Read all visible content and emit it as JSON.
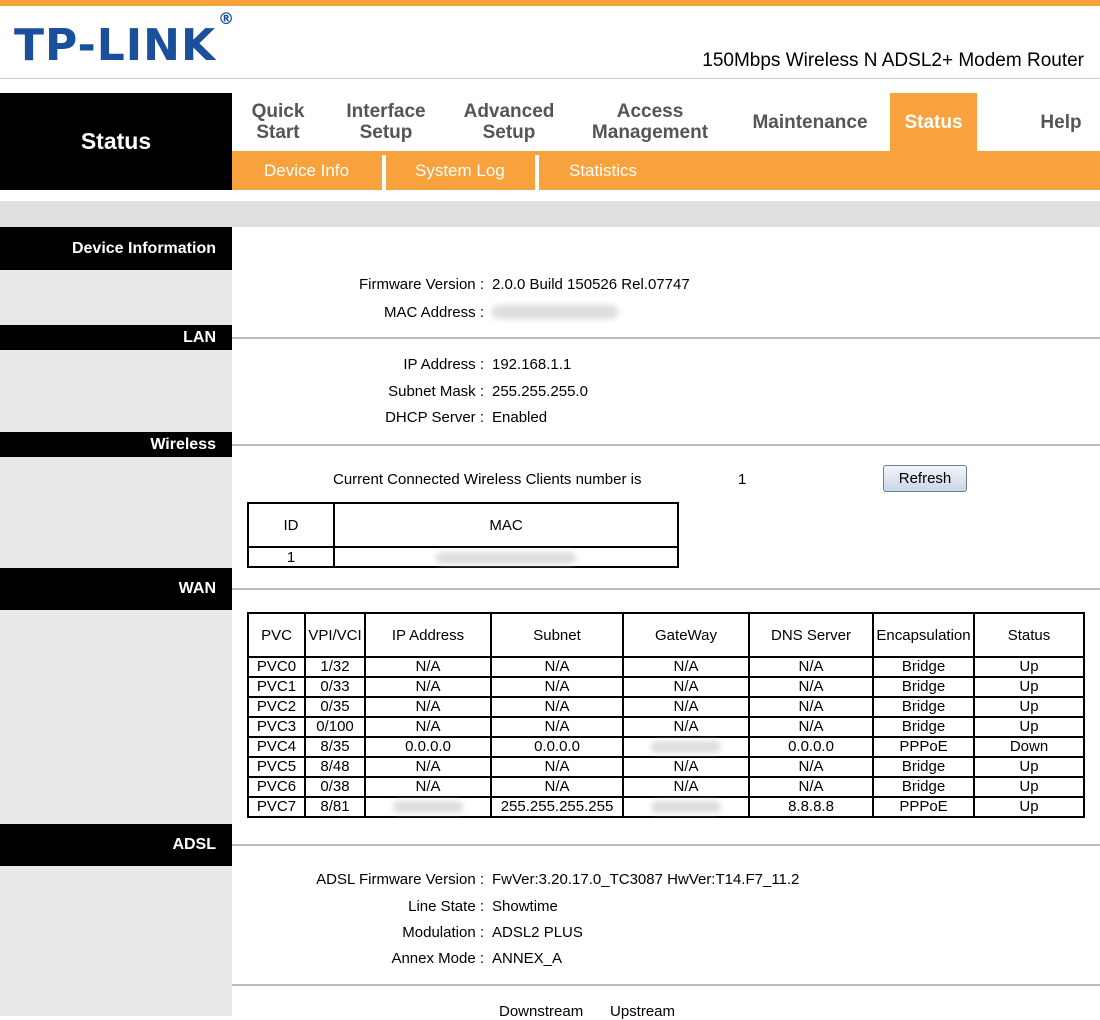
{
  "brand": {
    "logo": "TP-LINK",
    "reg": "®",
    "model": "150Mbps Wireless N ADSL2+ Modem Router"
  },
  "page_title": "Status",
  "nav": {
    "items": [
      "Quick Start",
      "Interface Setup",
      "Advanced Setup",
      "Access Management",
      "Maintenance",
      "Status",
      "Help"
    ],
    "active": "Status"
  },
  "subnav": {
    "items": [
      "Device Info",
      "System Log",
      "Statistics"
    ]
  },
  "sections": {
    "device_info": "Device Information",
    "lan": "LAN",
    "wireless": "Wireless",
    "wan": "WAN",
    "adsl": "ADSL"
  },
  "device": {
    "firmware_label": "Firmware Version :",
    "firmware_value": "2.0.0 Build 150526 Rel.07747",
    "mac_label": "MAC Address :"
  },
  "lan": {
    "ip_label": "IP Address :",
    "ip_value": "192.168.1.1",
    "subnet_label": "Subnet Mask :",
    "subnet_value": "255.255.255.0",
    "dhcp_label": "DHCP Server :",
    "dhcp_value": "Enabled"
  },
  "wireless": {
    "clients_label": "Current Connected Wireless Clients number is",
    "clients_count": "1",
    "refresh_label": "Refresh",
    "columns": [
      "ID",
      "MAC"
    ],
    "rows": [
      {
        "id": "1"
      }
    ]
  },
  "wan": {
    "columns": [
      "PVC",
      "VPI/VCI",
      "IP Address",
      "Subnet",
      "GateWay",
      "DNS Server",
      "Encapsulation",
      "Status"
    ],
    "rows": [
      [
        "PVC0",
        "1/32",
        "N/A",
        "N/A",
        "N/A",
        "N/A",
        "Bridge",
        "Up"
      ],
      [
        "PVC1",
        "0/33",
        "N/A",
        "N/A",
        "N/A",
        "N/A",
        "Bridge",
        "Up"
      ],
      [
        "PVC2",
        "0/35",
        "N/A",
        "N/A",
        "N/A",
        "N/A",
        "Bridge",
        "Up"
      ],
      [
        "PVC3",
        "0/100",
        "N/A",
        "N/A",
        "N/A",
        "N/A",
        "Bridge",
        "Up"
      ],
      [
        "PVC4",
        "8/35",
        "0.0.0.0",
        "0.0.0.0",
        "",
        "0.0.0.0",
        "PPPoE",
        "Down"
      ],
      [
        "PVC5",
        "8/48",
        "N/A",
        "N/A",
        "N/A",
        "N/A",
        "Bridge",
        "Up"
      ],
      [
        "PVC6",
        "0/38",
        "N/A",
        "N/A",
        "N/A",
        "N/A",
        "Bridge",
        "Up"
      ],
      [
        "PVC7",
        "8/81",
        "",
        "255.255.255.255",
        "",
        "8.8.8.8",
        "PPPoE",
        "Up"
      ]
    ]
  },
  "adsl": {
    "fw_label": "ADSL Firmware Version :",
    "fw_value": "FwVer:3.20.17.0_TC3087 HwVer:T14.F7_11.2",
    "line_label": "Line State :",
    "line_value": "Showtime",
    "mod_label": "Modulation :",
    "mod_value": "ADSL2 PLUS",
    "annex_label": "Annex Mode :",
    "annex_value": "ANNEX_A",
    "downstream": "Downstream",
    "upstream": "Upstream"
  },
  "colors": {
    "accent": "#f7a23d",
    "logo": "#1a4f9c",
    "header_black": "#000000",
    "sidebar": "#e8e8e8"
  }
}
